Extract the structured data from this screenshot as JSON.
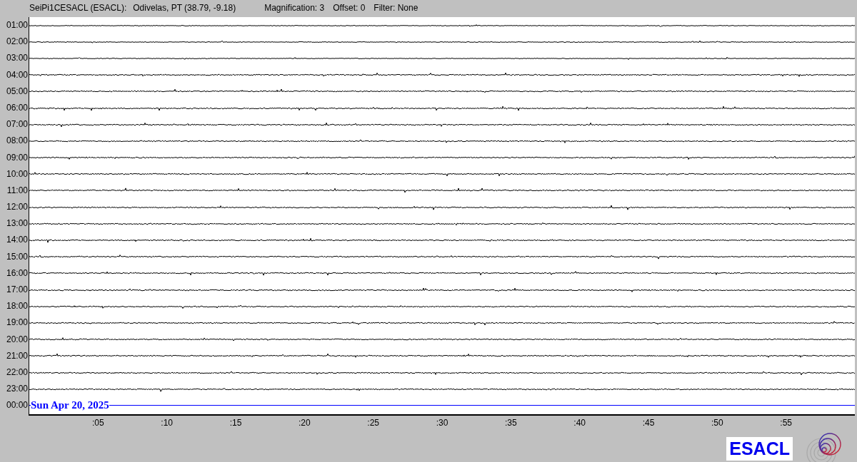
{
  "header": {
    "station": "SeiPi1CESACL (ESACL):",
    "location": "Odivelas, PT (38.79, -9.18)",
    "magnification": "Magnification: 3",
    "offset": "Offset: 0",
    "filter": "Filter: None"
  },
  "rows": [
    {
      "label": "01:00",
      "kind": "trace"
    },
    {
      "label": "02:00",
      "kind": "trace"
    },
    {
      "label": "03:00",
      "kind": "trace"
    },
    {
      "label": "04:00",
      "kind": "trace"
    },
    {
      "label": "05:00",
      "kind": "trace"
    },
    {
      "label": "06:00",
      "kind": "trace"
    },
    {
      "label": "07:00",
      "kind": "trace"
    },
    {
      "label": "08:00",
      "kind": "trace"
    },
    {
      "label": "09:00",
      "kind": "trace"
    },
    {
      "label": "10:00",
      "kind": "trace"
    },
    {
      "label": "11:00",
      "kind": "trace"
    },
    {
      "label": "12:00",
      "kind": "trace"
    },
    {
      "label": "13:00",
      "kind": "trace"
    },
    {
      "label": "14:00",
      "kind": "trace"
    },
    {
      "label": "15:00",
      "kind": "trace"
    },
    {
      "label": "16:00",
      "kind": "trace"
    },
    {
      "label": "17:00",
      "kind": "trace"
    },
    {
      "label": "18:00",
      "kind": "trace"
    },
    {
      "label": "19:00",
      "kind": "trace"
    },
    {
      "label": "20:00",
      "kind": "trace"
    },
    {
      "label": "21:00",
      "kind": "trace"
    },
    {
      "label": "22:00",
      "kind": "trace"
    },
    {
      "label": "23:00",
      "kind": "trace"
    },
    {
      "label": "00:00",
      "kind": "current",
      "date": "Sun Apr 20, 2025"
    }
  ],
  "xticks": [
    ":05",
    ":10",
    ":15",
    ":20",
    ":25",
    ":30",
    ":35",
    ":40",
    ":45",
    ":50",
    ":55"
  ],
  "logo": "ESACL"
}
